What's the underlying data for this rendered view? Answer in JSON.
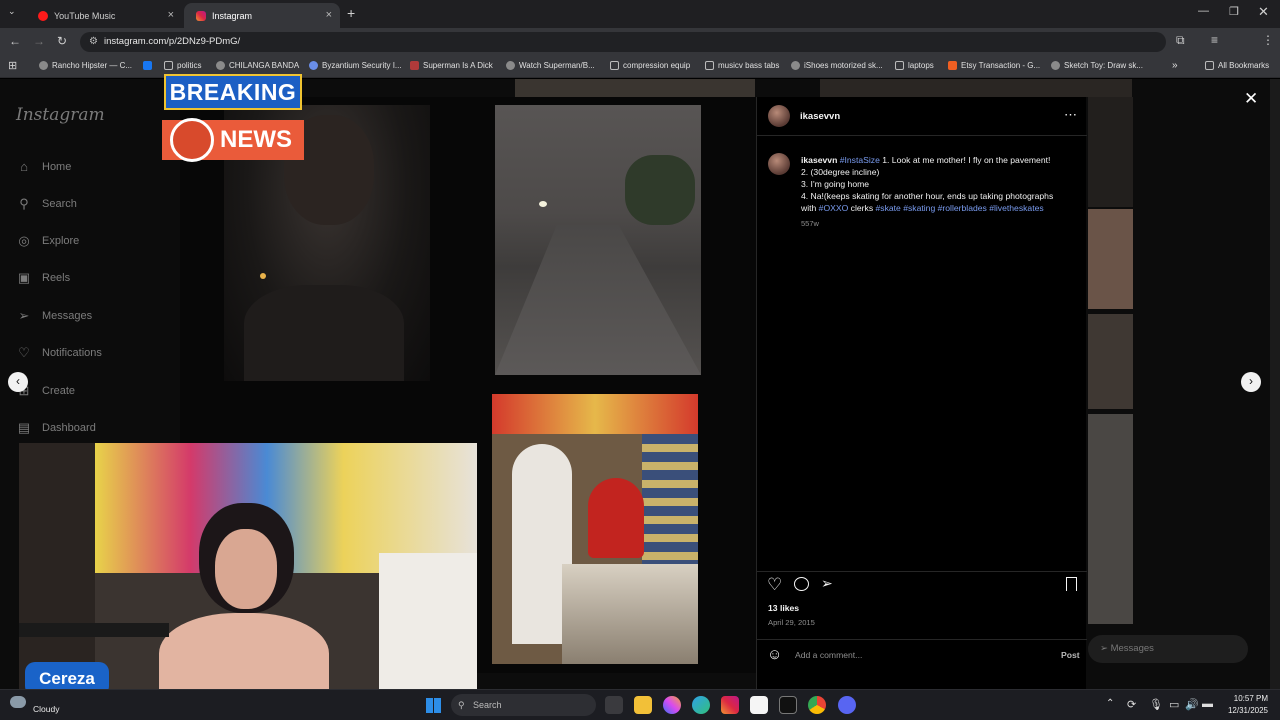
{
  "browser": {
    "tabs": [
      {
        "title": "YouTube Music",
        "active": false
      },
      {
        "title": "Instagram",
        "active": true
      }
    ],
    "url": "instagram.com/p/2DNz9-PDmG/",
    "bookmarks": [
      "Rancho Hipster — C...",
      "politics",
      "CHILANGA BANDA",
      "Byzantium Security I...",
      "Superman Is A Dick",
      "Watch Superman/B...",
      "compression equip",
      "musicv bass tabs",
      "iShoes motorized sk...",
      "laptops",
      "Etsy Transaction - G...",
      "Sketch Toy: Draw sk..."
    ],
    "all_bookmarks": "All Bookmarks"
  },
  "instagram": {
    "logo": "Instagram",
    "nav": [
      "Home",
      "Search",
      "Explore",
      "Reels",
      "Messages",
      "Notifications",
      "Create",
      "Dashboard"
    ]
  },
  "post": {
    "username": "ikasevvn",
    "caption_user": "ikasevvn",
    "caption_line1_tag": "#InstaSize",
    "caption_line1_text": " 1. Look at me mother! I fly on the pavement!",
    "caption_line2": "2. (30degree incline)",
    "caption_line3": "3. I'm going home",
    "caption_line4": "4. Na!(keeps skating for another hour, ends up taking photographs",
    "caption_line5_pre": "with ",
    "caption_line5_tag1": "#OXXO",
    "caption_line5_mid": " clerks ",
    "caption_line5_tags": "#skate #skating #rollerblades #livetheskates",
    "age": "557w",
    "likes": "13 likes",
    "date": "April 29, 2015",
    "comment_placeholder": "Add a comment...",
    "post_button": "Post"
  },
  "overlay": {
    "breaking": "BREAKING",
    "news": "NEWS",
    "streamer_name": "Cereza"
  },
  "messages_label": "Messages",
  "taskbar": {
    "weather": "Cloudy",
    "search_placeholder": "Search",
    "time": "10:57 PM",
    "date": "12/31/2025"
  }
}
